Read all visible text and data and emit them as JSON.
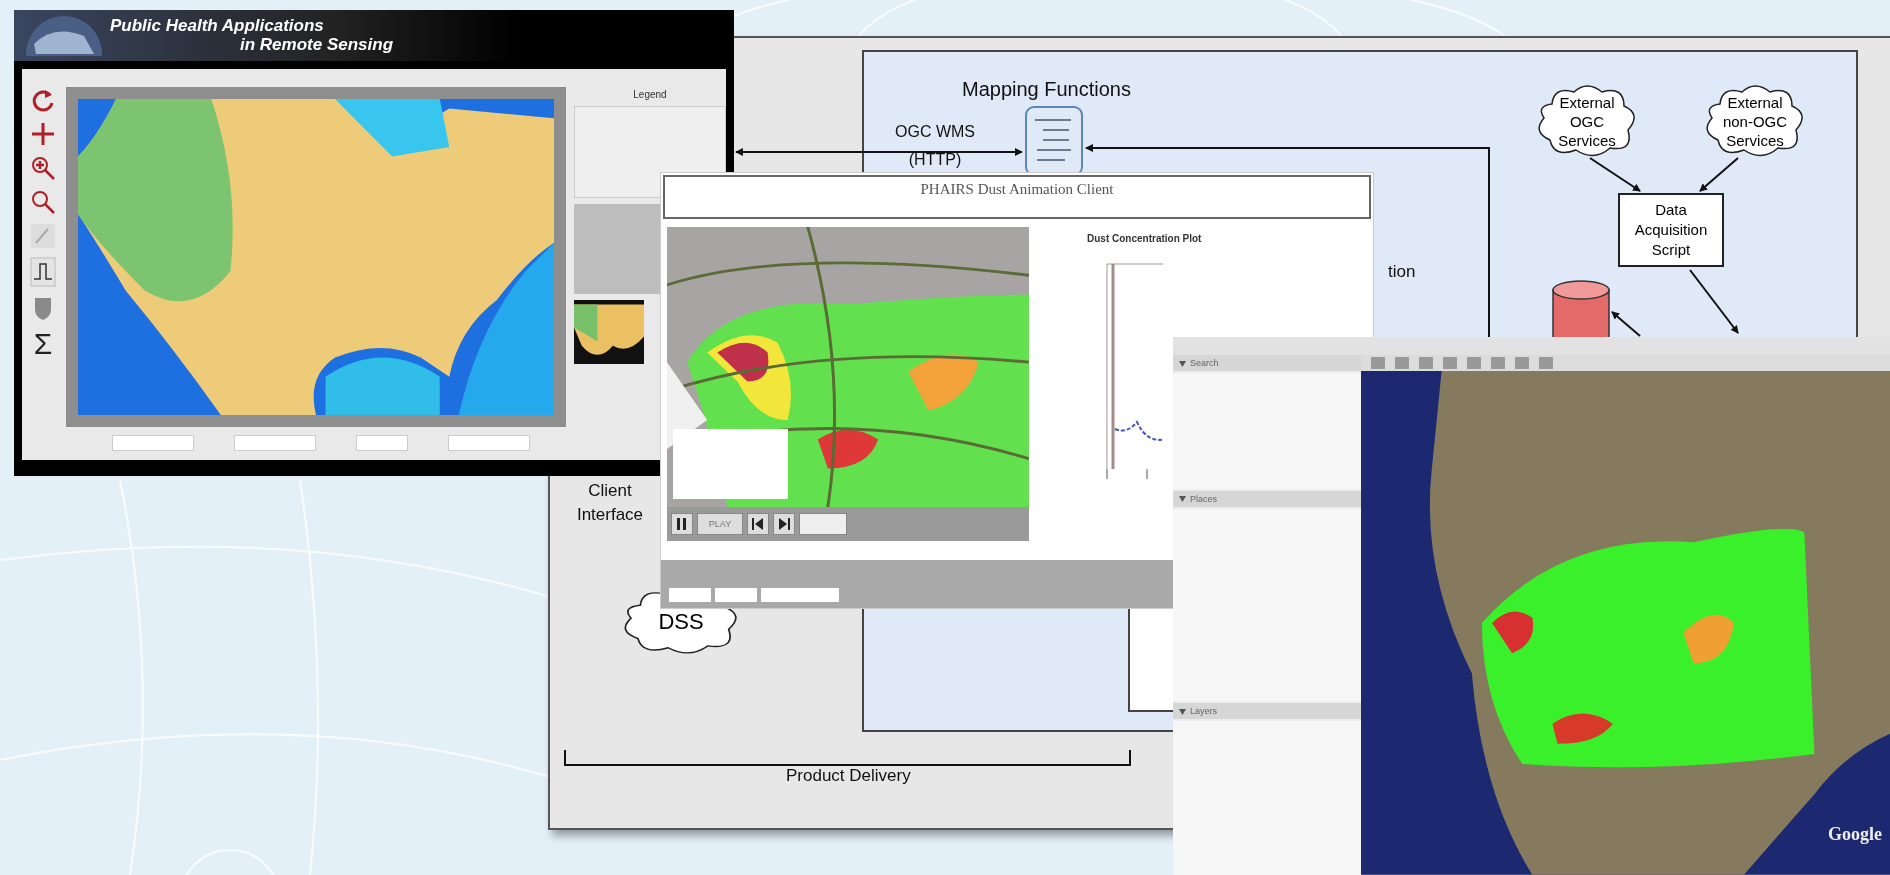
{
  "diagram": {
    "mapping_title": "Mapping Functions",
    "protocol_label": "OGC WMS (HTTP)",
    "clouds": [
      {
        "label": "External OGC Services"
      },
      {
        "label": "External non-OGC Services"
      }
    ],
    "acquisition_box": "Data Acquisition Script",
    "cut_label": "tion",
    "client_label": "Client Interface",
    "dss_label": "DSS",
    "delivery_label": "Product Delivery"
  },
  "remote_sensing_window": {
    "title_lines": [
      "Public Health Applications",
      "in Remote Sensing"
    ],
    "legend_title": "Legend",
    "toolbar_glyph": "Σ"
  },
  "dust_client_window": {
    "title": "PHAIRS Dust Animation Client",
    "plot_title": "Dust Concentration Plot",
    "play_label": "PLAY"
  },
  "earth_window": {
    "panels": [
      {
        "title": "Search",
        "expanded": true
      },
      {
        "title": "Places",
        "expanded": true
      },
      {
        "title": "Layers",
        "expanded": true
      }
    ],
    "logo": "Google"
  }
}
